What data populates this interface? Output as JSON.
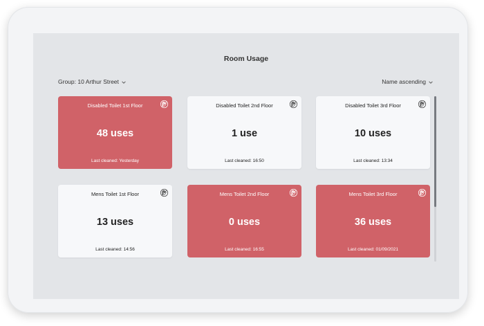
{
  "page": {
    "title": "Room Usage",
    "group_label": "Group: 10 Arthur Street",
    "sort_label": "Name ascending"
  },
  "cards": [
    {
      "name": "Disabled Toilet 1st Floor",
      "uses": "48 uses",
      "cleaned": "Last cleaned: Yesterday",
      "status": "red"
    },
    {
      "name": "Disabled Toilet 2nd Floor",
      "uses": "1 use",
      "cleaned": "Last cleaned: 16:50",
      "status": "white"
    },
    {
      "name": "Disabled Toilet 3rd Floor",
      "uses": "10 uses",
      "cleaned": "Last cleaned: 13:34",
      "status": "white"
    },
    {
      "name": "Mens Toilet 1st Floor",
      "uses": "13 uses",
      "cleaned": "Last cleaned: 14:56",
      "status": "white"
    },
    {
      "name": "Mens Toilet 2nd Floor",
      "uses": "0 uses",
      "cleaned": "Last cleaned: 16:55",
      "status": "red"
    },
    {
      "name": "Mens Toilet 3rd Floor",
      "uses": "36 uses",
      "cleaned": "Last cleaned: 01/09/2021",
      "status": "red"
    }
  ],
  "icons": {
    "card_icon": "hand-wash-icon",
    "dropdown": "chevron-down-icon"
  },
  "colors": {
    "alert_card": "#d06268",
    "normal_card": "#f7f8fa",
    "screen_bg": "#e3e5e8"
  }
}
